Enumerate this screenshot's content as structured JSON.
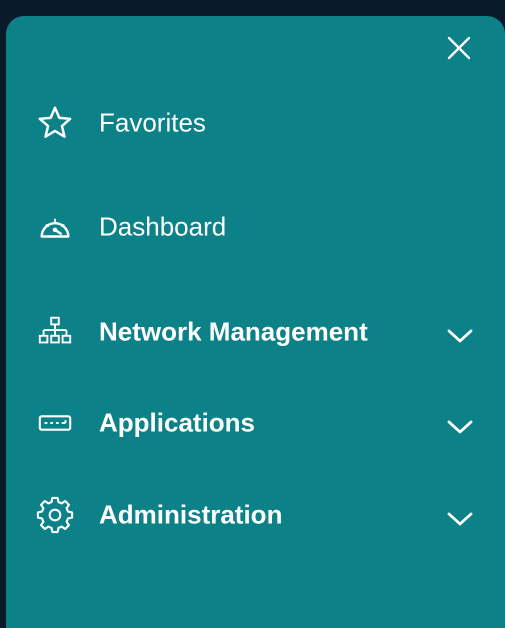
{
  "colors": {
    "panel_background": "#0c8288",
    "backdrop": "#0b1a2a",
    "text": "#ffffff"
  },
  "menu": {
    "close_icon": "close-icon",
    "items": [
      {
        "label": "Favorites",
        "icon": "star-icon",
        "expandable": false,
        "bold": false
      },
      {
        "label": "Dashboard",
        "icon": "speedometer-icon",
        "expandable": false,
        "bold": false
      },
      {
        "label": "Network Management",
        "icon": "network-tree-icon",
        "expandable": true,
        "bold": true
      },
      {
        "label": "Applications",
        "icon": "keyboard-icon",
        "expandable": true,
        "bold": true
      },
      {
        "label": "Administration",
        "icon": "gear-icon",
        "expandable": true,
        "bold": true
      }
    ]
  }
}
